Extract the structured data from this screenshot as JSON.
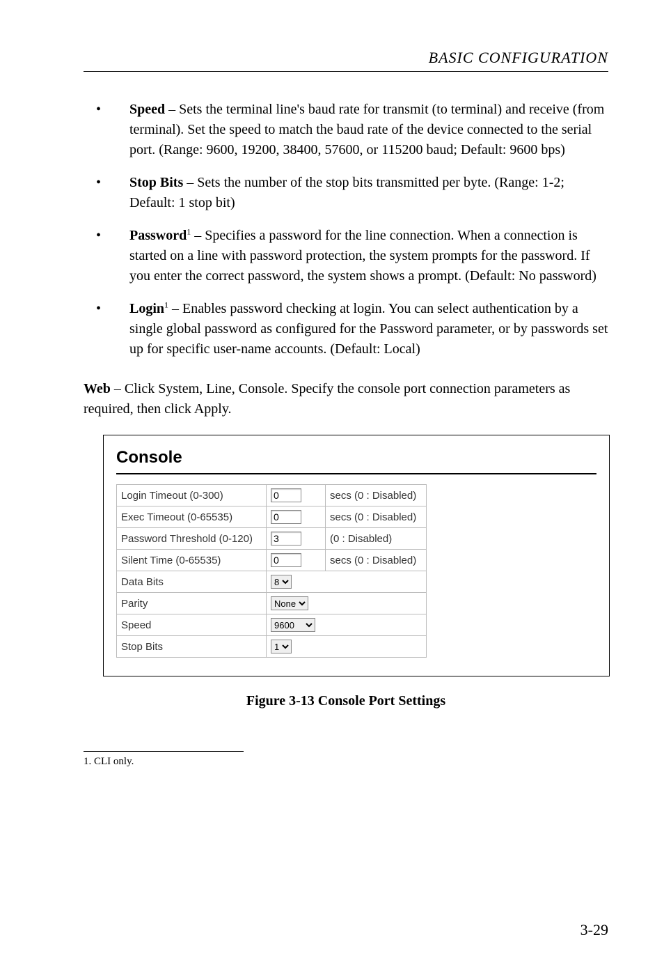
{
  "header": {
    "title": "BASIC CONFIGURATION"
  },
  "bullets": [
    {
      "term": "Speed",
      "sup": "",
      "text": " – Sets the terminal line's baud rate for transmit (to terminal) and receive (from terminal). Set the speed to match the baud rate of the device connected to the serial port. (Range: 9600, 19200, 38400, 57600, or 115200 baud; Default: 9600 bps)"
    },
    {
      "term": "Stop Bits",
      "sup": "",
      "text": " – Sets the number of the stop bits transmitted per byte. (Range: 1-2; Default: 1 stop bit)"
    },
    {
      "term": "Password",
      "sup": "1",
      "text": " – Specifies a password for the line connection. When a connection is started on a line with password protection, the system prompts for the password. If you enter the correct password, the system shows a prompt. (Default: No password)"
    },
    {
      "term": "Login",
      "sup": "1",
      "text": " – Enables password checking at login. You can select authentication by a single global password as configured for the Password parameter, or by passwords set up for specific user-name accounts. (Default: Local)"
    }
  ],
  "webpara": {
    "lead": "Web",
    "rest": " – Click System, Line, Console. Specify the console port connection parameters as required, then click Apply."
  },
  "figure": {
    "title": "Console",
    "rows": {
      "loginTimeout": {
        "label": "Login Timeout (0-300)",
        "value": "0",
        "suffix": "secs (0 : Disabled)"
      },
      "execTimeout": {
        "label": "Exec Timeout (0-65535)",
        "value": "0",
        "suffix": "secs (0 : Disabled)"
      },
      "passwordThreshold": {
        "label": "Password Threshold (0-120)",
        "value": "3",
        "suffix": "(0 : Disabled)"
      },
      "silentTime": {
        "label": "Silent Time (0-65535)",
        "value": "0",
        "suffix": "secs (0 : Disabled)"
      },
      "dataBits": {
        "label": "Data Bits",
        "value": "8"
      },
      "parity": {
        "label": "Parity",
        "value": "None"
      },
      "speed": {
        "label": "Speed",
        "value": "9600"
      },
      "stopBits": {
        "label": "Stop Bits",
        "value": "1"
      }
    }
  },
  "caption": "Figure 3-13  Console Port Settings",
  "footnote": {
    "marker": "1.",
    "text": "CLI only."
  },
  "pagenum": "3-29"
}
